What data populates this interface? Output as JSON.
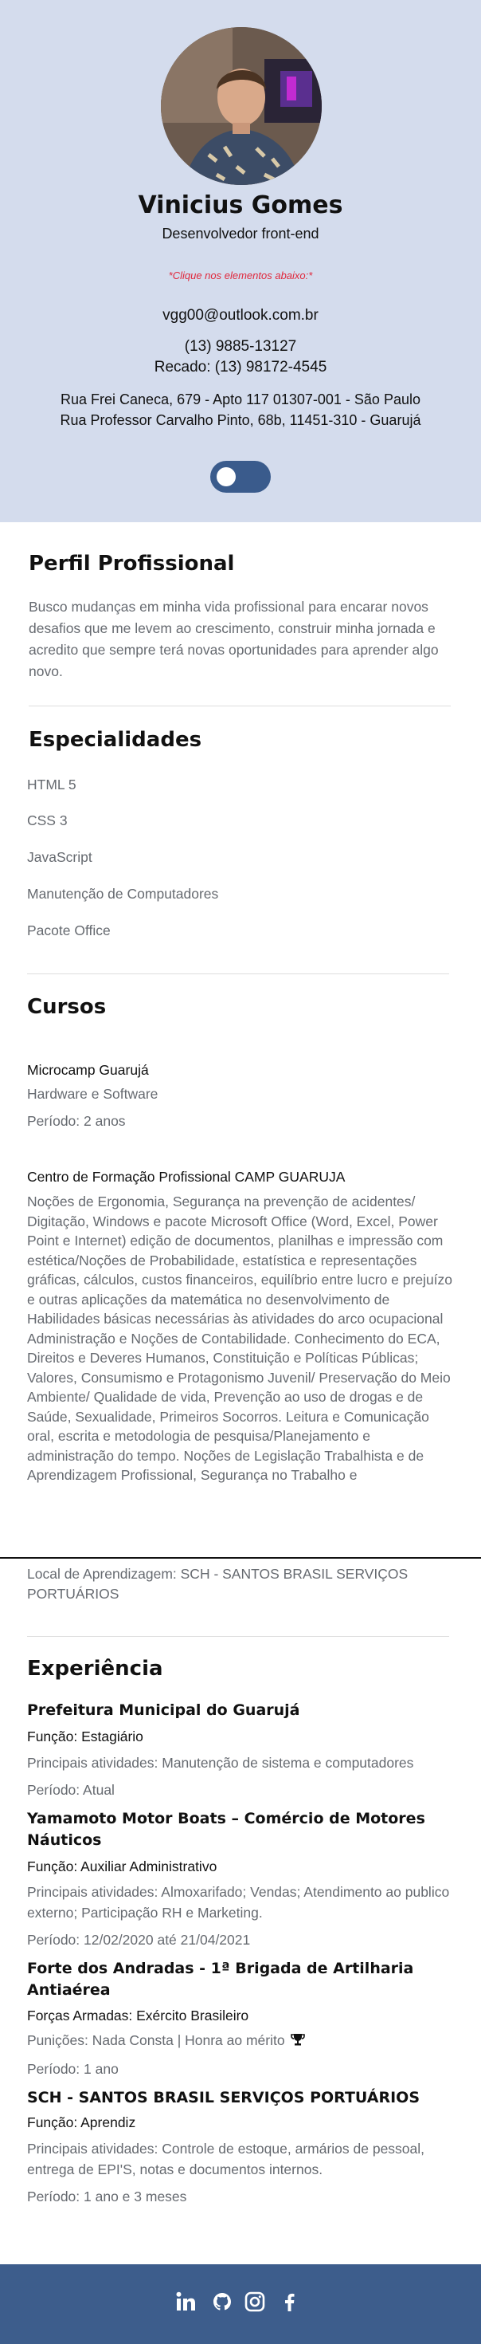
{
  "profile": {
    "name": "Vinicius Gomes",
    "role": "Desenvolvedor front-end",
    "hint": "*Clique nos elementos abaixo:*",
    "email": "vgg00@outlook.com.br",
    "phone1": "(13) 9885-13127",
    "phone2": "Recado: (13) 98172-4545",
    "address1": "Rua Frei Caneca, 679 - Apto 117 01307-001 - São Paulo",
    "address2": "Rua Professor Carvalho Pinto, 68b, 11451-310 - Guarujá"
  },
  "perfil": {
    "title": "Perfil Profissional",
    "text": "Busco mudanças em minha vida profissional para encarar novos desafios que me levem ao crescimento, construir minha jornada e acredito que sempre terá novas oportunidades para aprender algo novo."
  },
  "especialidades": {
    "title": "Especialidades",
    "items": [
      "HTML 5",
      "CSS 3",
      "JavaScript",
      "Manutenção de Computadores",
      "Pacote Office"
    ]
  },
  "cursos": {
    "title": "Cursos",
    "c1_title": "Microcamp Guarujá",
    "c1_line1": "Hardware e Software",
    "c1_line2": "Período: 2 anos",
    "c2_title": "Centro de Formação Profissional CAMP GUARUJA",
    "c2_desc": "Noções de Ergonomia, Segurança na prevenção de acidentes/ Digitação, Windows e pacote Microsoft Office (Word, Excel, Power Point e Internet) edição de documentos, planilhas e impressão com estética/Noções de Probabilidade, estatística e representações gráficas, cálculos, custos financeiros, equilíbrio entre lucro e prejuízo e outras aplicações da matemática no desenvolvimento de Habilidades básicas necessárias às atividades do arco ocupacional Administração e Noções de Contabilidade. Conhecimento do ECA, Direitos e Deveres Humanos, Constituição e Políticas Públicas; Valores, Consumismo e Protagonismo Juvenil/ Preservação do Meio Ambiente/ Qualidade de vida, Prevenção ao uso de drogas e de Saúde, Sexualidade, Primeiros Socorros. Leitura e Comunicação oral, escrita e metodologia de pesquisa/Planejamento e administração do tempo. Noções de Legislação Trabalhista e de Aprendizagem Profissional, Segurança no Trabalho e",
    "c2_local": "Local de Aprendizagem: SCH - SANTOS BRASIL SERVIÇOS PORTUÁRIOS"
  },
  "experiencia": {
    "title": "Experiência",
    "e1_company": "Prefeitura Municipal do Guarujá",
    "e1_role": "Função: Estagiário",
    "e1_activities": "Principais atividades: Manutenção de sistema e computadores",
    "e1_period": "Período: Atual",
    "e2_company": "Yamamoto Motor Boats – Comércio de Motores Náuticos",
    "e2_role": "Função: Auxiliar Administrativo",
    "e2_activities": "Principais atividades: Almoxarifado; Vendas; Atendimento ao publico externo; Participação RH e Marketing.",
    "e2_period": "Período: 12/02/2020 até 21/04/2021",
    "e3_company": "Forte dos Andradas - 1ª Brigada de Artilharia Antiaérea",
    "e3_role": "Forças Armadas: Exército Brasileiro",
    "e3_punishments": "Punições: Nada Consta | Honra ao mérito",
    "e3_period": "Período: 1 ano",
    "e4_company": "SCH - SANTOS BRASIL SERVIÇOS PORTUÁRIOS",
    "e4_role": "Função: Aprendiz",
    "e4_activities": "Principais atividades: Controle de estoque, armários de pessoal, entrega de EPI'S, notas e documentos internos.",
    "e4_period": "Período: 1 ano e 3 meses"
  },
  "footer": {
    "icons": [
      "linkedin-icon",
      "github-icon",
      "instagram-icon",
      "facebook-icon"
    ]
  },
  "colors": {
    "header_bg": "#d4dced",
    "toggle": "#3a5b8c",
    "footer_bg": "#3d5d8c",
    "hint_red": "#e0283c"
  }
}
